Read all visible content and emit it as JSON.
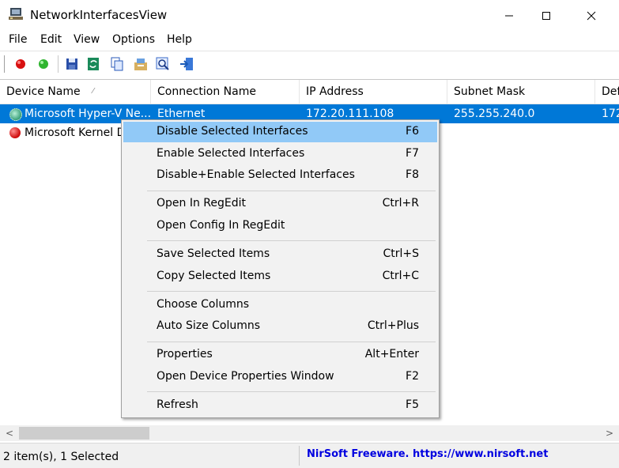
{
  "window": {
    "title": "NetworkInterfacesView"
  },
  "menu": [
    "File",
    "Edit",
    "View",
    "Options",
    "Help"
  ],
  "toolbar": {
    "icons": [
      "red-circle-icon",
      "green-circle-icon",
      "save-icon",
      "refresh-icon",
      "copy-icon",
      "properties-icon",
      "find-icon",
      "exit-icon"
    ]
  },
  "table": {
    "columns": [
      "Device Name",
      "Connection Name",
      "IP Address",
      "Subnet Mask",
      "Def"
    ],
    "sort_indicator": "⁄",
    "rows": [
      {
        "device": "Microsoft Hyper-V Ne...",
        "connection": "Ethernet",
        "ip": "172.20.111.108",
        "mask": "255.255.240.0",
        "def": "172",
        "status": "green"
      },
      {
        "device": "Microsoft Kernel D",
        "connection": "",
        "ip": "",
        "mask": "",
        "def": "",
        "status": "red"
      }
    ]
  },
  "context_menu": {
    "items": [
      {
        "label": "Disable Selected Interfaces",
        "key": "F6"
      },
      {
        "label": "Enable Selected Interfaces",
        "key": "F7"
      },
      {
        "label": "Disable+Enable Selected Interfaces",
        "key": "F8"
      },
      {
        "label": "Open In RegEdit",
        "key": "Ctrl+R"
      },
      {
        "label": "Open Config In RegEdit",
        "key": ""
      },
      {
        "label": "Save Selected Items",
        "key": "Ctrl+S"
      },
      {
        "label": "Copy Selected Items",
        "key": "Ctrl+C"
      },
      {
        "label": "Choose Columns",
        "key": ""
      },
      {
        "label": "Auto Size Columns",
        "key": "Ctrl+Plus"
      },
      {
        "label": "Properties",
        "key": "Alt+Enter"
      },
      {
        "label": "Open Device Properties Window",
        "key": "F2"
      },
      {
        "label": "Refresh",
        "key": "F5"
      }
    ]
  },
  "scrollbar": {
    "left": "<",
    "right": ">"
  },
  "status": {
    "count": "2 item(s), 1 Selected",
    "link": "NirSoft Freeware. https://www.nirsoft.net"
  },
  "colors": {
    "selection": "#0078d7",
    "menu_highlight": "#91c9f7",
    "link": "#0000e0"
  }
}
